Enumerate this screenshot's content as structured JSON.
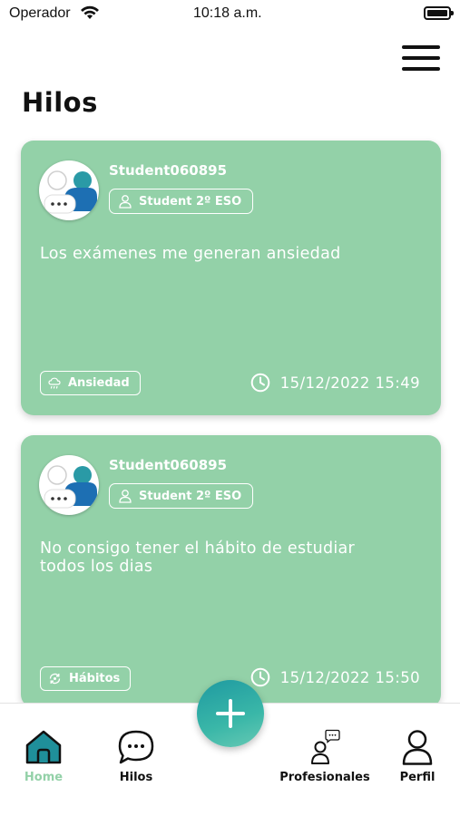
{
  "status_bar": {
    "carrier": "Operador",
    "time": "10:18 a.m."
  },
  "header": {
    "title": "Hilos",
    "menu_icon": "hamburger-menu-icon"
  },
  "threads": [
    {
      "username": "Student060895",
      "role": "Student 2º ESO",
      "title": "Los exámenes me generan ansiedad",
      "tag": "Ansiedad",
      "tag_icon": "cloud-rain-icon",
      "timestamp": "15/12/2022 15:49"
    },
    {
      "username": "Student060895",
      "role": "Student 2º ESO",
      "title": "No consigo tener el hábito de estudiar todos los dias",
      "tag": "Hábitos",
      "tag_icon": "habit-cycle-icon",
      "timestamp": "15/12/2022 15:50"
    }
  ],
  "bottom_nav": {
    "items": [
      {
        "label": "Home",
        "icon": "home-icon",
        "active": true
      },
      {
        "label": "Hilos",
        "icon": "chat-bubble-icon",
        "active": false
      },
      {
        "label": "Profesionales",
        "icon": "professional-chat-icon",
        "active": false
      },
      {
        "label": "Perfil",
        "icon": "person-icon",
        "active": false
      }
    ],
    "fab_icon": "plus-icon"
  },
  "colors": {
    "card_bg": "#93d1a8",
    "accent": "#1f9aa1",
    "active_nav": "#93d1a8",
    "text_dark": "#111111"
  }
}
